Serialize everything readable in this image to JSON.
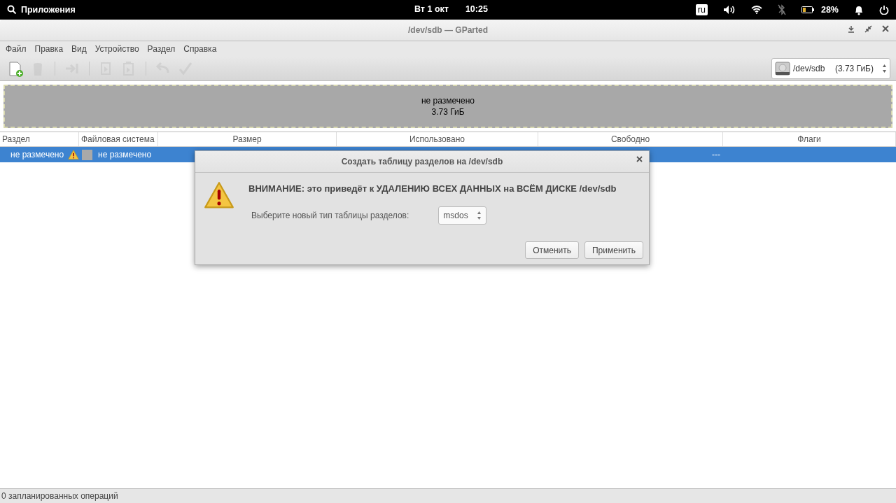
{
  "top_bar": {
    "apps_label": "Приложения",
    "date": "Вт  1 окт",
    "time": "10:25",
    "keyboard_layout": "ru",
    "battery": "28%"
  },
  "window": {
    "title": "/dev/sdb — GParted"
  },
  "menu": [
    "Файл",
    "Правка",
    "Вид",
    "Устройство",
    "Раздел",
    "Справка"
  ],
  "toolbar": [
    {
      "kind": "button",
      "disabled": false
    },
    {
      "kind": "button",
      "disabled": true
    },
    {
      "kind": "separator"
    },
    {
      "kind": "button",
      "disabled": true
    },
    {
      "kind": "separator"
    },
    {
      "kind": "button",
      "disabled": true
    },
    {
      "kind": "button",
      "disabled": true
    },
    {
      "kind": "separator"
    },
    {
      "kind": "button",
      "disabled": true
    },
    {
      "kind": "button",
      "disabled": true
    }
  ],
  "device_selector": {
    "device": "/dev/sdb",
    "size": "(3.73 ГиБ)"
  },
  "disk_map": {
    "label": "не размечено",
    "size": "3.73 ГиБ"
  },
  "table": {
    "columns": [
      "Раздел",
      "Файловая система",
      "Размер",
      "Использовано",
      "Свободно",
      "Флаги"
    ],
    "rows": [
      {
        "selected": true,
        "partition": "не размечено",
        "warning": true,
        "color": "#a9a9a9",
        "filesystem": "не размечено",
        "free": "---"
      }
    ]
  },
  "dialog": {
    "title": "Создать таблицу разделов на /dev/sdb",
    "warning": "ВНИМАНИЕ: это приведёт к УДАЛЕНИЮ ВСЕХ ДАННЫХ на ВСЁМ ДИСКЕ /dev/sdb",
    "type_label": "Выберите новый тип таблицы разделов:",
    "type_value": "msdos",
    "buttons": [
      "Отменить",
      "Применить"
    ]
  },
  "status_bar": "0 запланированных операций"
}
